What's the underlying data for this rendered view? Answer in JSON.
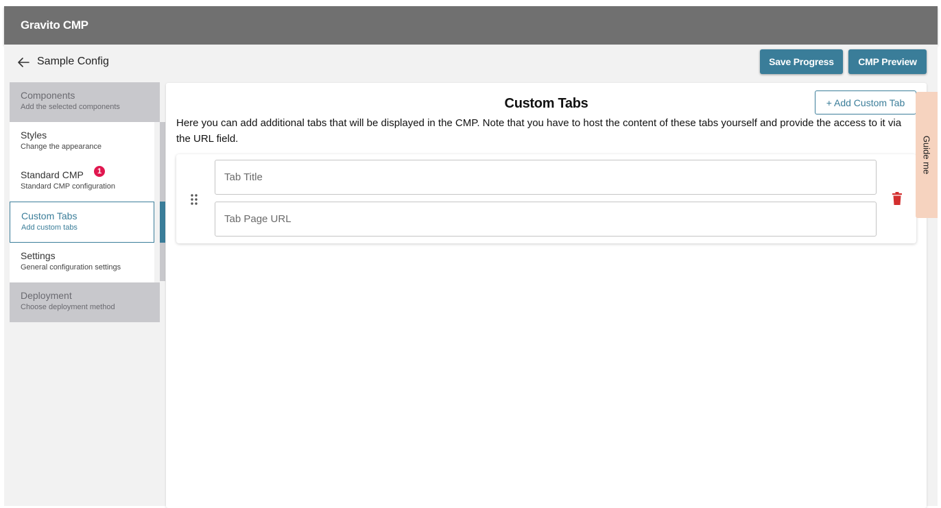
{
  "header": {
    "app_title": "Gravito CMP"
  },
  "toolbar": {
    "config_name": "Sample Config",
    "save_label": "Save Progress",
    "preview_label": "CMP Preview"
  },
  "sidebar": {
    "items": [
      {
        "title": "Components",
        "subtitle": "Add the selected components"
      },
      {
        "title": "Styles",
        "subtitle": "Change the appearance"
      },
      {
        "title": "Standard CMP",
        "subtitle": "Standard CMP configuration",
        "badge": "1"
      },
      {
        "title": "Custom Tabs",
        "subtitle": "Add custom tabs"
      },
      {
        "title": "Settings",
        "subtitle": "General configuration settings"
      },
      {
        "title": "Deployment",
        "subtitle": "Choose deployment method"
      }
    ],
    "active_index": 3
  },
  "main": {
    "title": "Custom Tabs",
    "add_button_label": "+ Add Custom Tab",
    "description": "Here you can add additional tabs that will be displayed in the CMP. Note that you have to host the content of these tabs yourself and provide the access to it via the URL field.",
    "tab": {
      "title_placeholder": "Tab Title",
      "title_value": "",
      "url_placeholder": "Tab Page URL",
      "url_value": ""
    }
  },
  "guide": {
    "label": "Guide me"
  },
  "colors": {
    "accent": "#3a7d99",
    "topbar": "#707070",
    "badge": "#e0174f",
    "delete": "#d32f2f",
    "guide_tab": "#f6d3bf"
  }
}
